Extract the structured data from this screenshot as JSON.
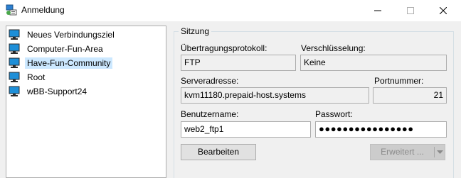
{
  "window": {
    "title": "Anmeldung"
  },
  "tree": {
    "items": [
      {
        "label": "Neues Verbindungsziel",
        "selected": false
      },
      {
        "label": "Computer-Fun-Area",
        "selected": false
      },
      {
        "label": "Have-Fun-Community",
        "selected": true
      },
      {
        "label": "Root",
        "selected": false
      },
      {
        "label": "wBB-Support24",
        "selected": false
      }
    ]
  },
  "session": {
    "group_title": "Sitzung",
    "protocol_label": "Übertragungsprotokoll:",
    "protocol_value": "FTP",
    "encryption_label": "Verschlüsselung:",
    "encryption_value": "Keine",
    "server_label": "Serveradresse:",
    "server_value": "kvm11180.prepaid-host.systems",
    "port_label": "Portnummer:",
    "port_value": "21",
    "username_label": "Benutzername:",
    "username_value": "web2_ftp1",
    "password_label": "Passwort:",
    "password_value": "●●●●●●●●●●●●●●●●",
    "edit_button": "Bearbeiten",
    "advanced_button": "Erweitert ..."
  },
  "colors": {
    "selection": "#cce8ff",
    "window_bg": "#f0f0f0",
    "monitor_screen": "#1e8fd8"
  }
}
